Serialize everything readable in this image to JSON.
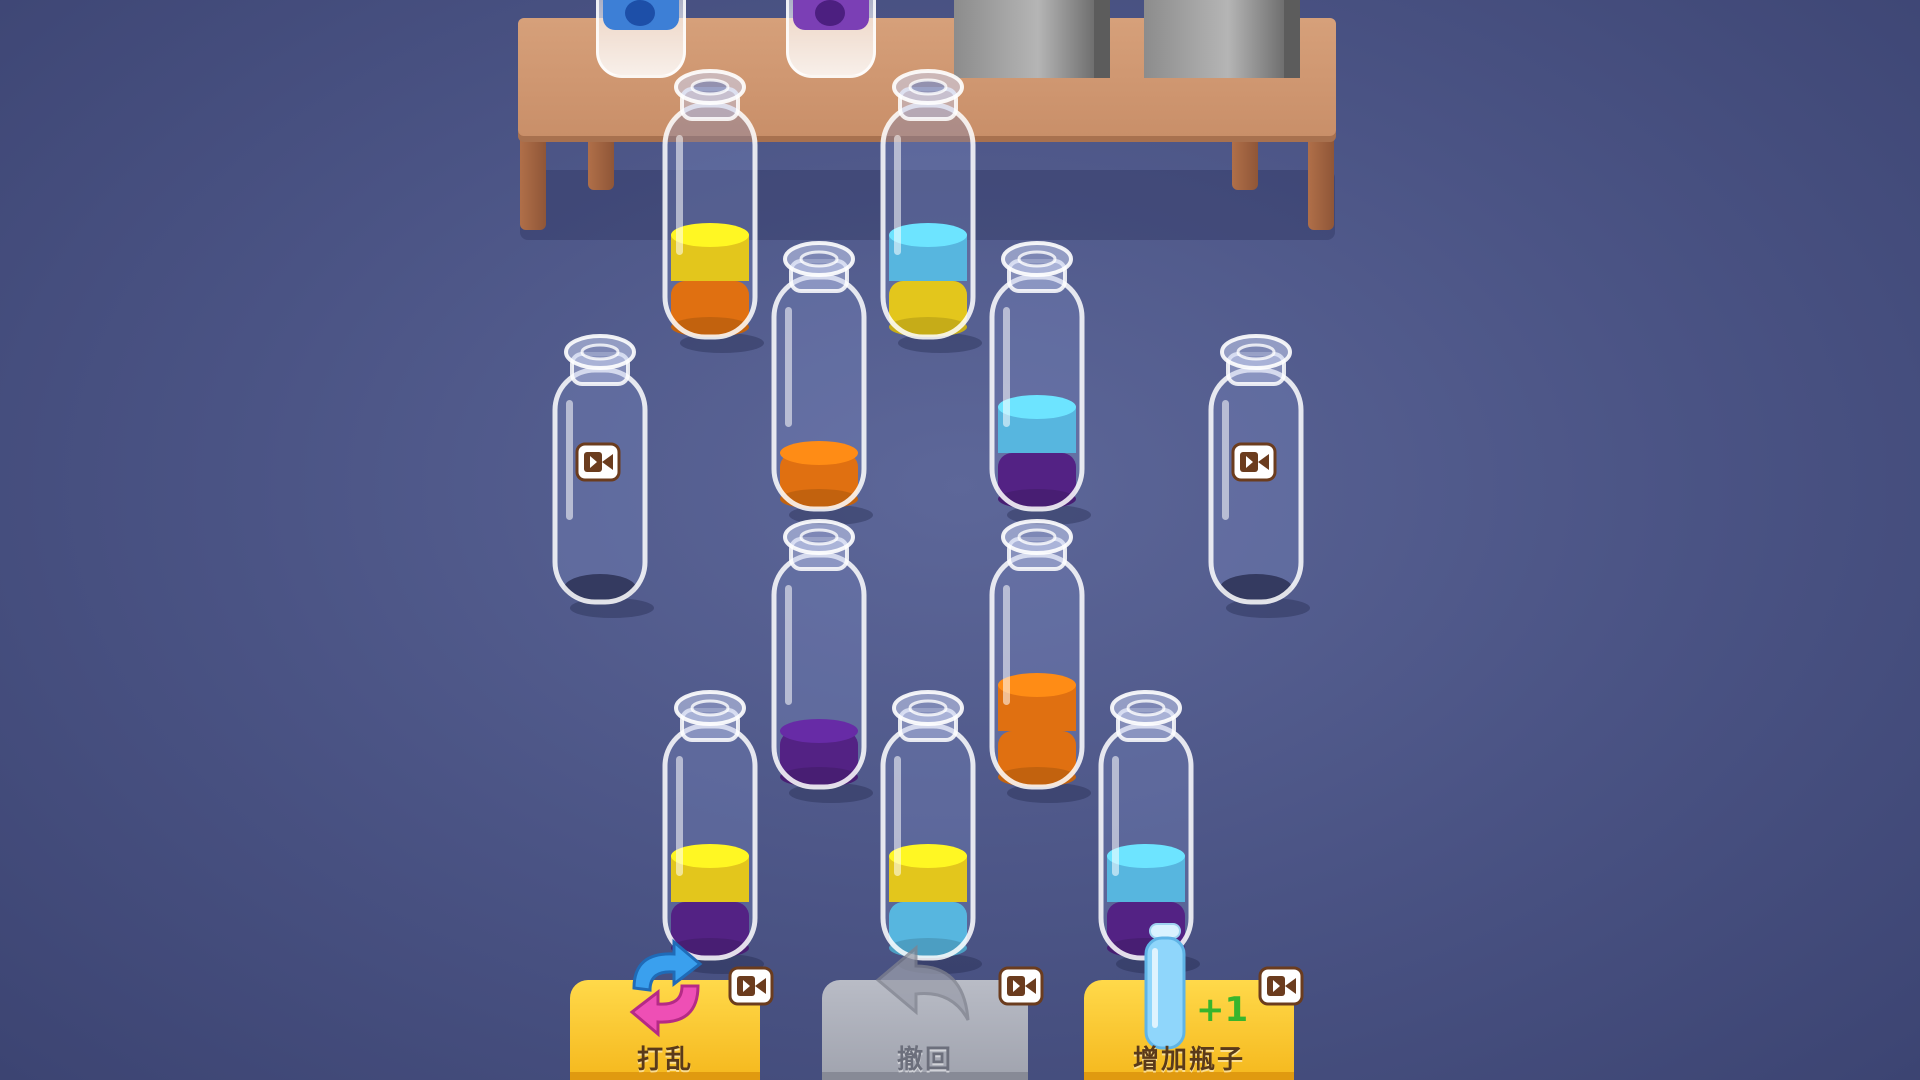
{
  "game": {
    "colors": {
      "yellow": "#f7d71e",
      "orange": "#f37a12",
      "cyan": "#5fc6f2",
      "purple": "#5a2590"
    },
    "bottle_capacity": 4,
    "bottles": [
      {
        "id": "b1",
        "layers": [
          "orange",
          "yellow"
        ],
        "locked": false
      },
      {
        "id": "b2",
        "layers": [
          "yellow",
          "cyan"
        ],
        "locked": false
      },
      {
        "id": "b3",
        "layers": [
          "orange"
        ],
        "locked": false
      },
      {
        "id": "b4",
        "layers": [
          "purple",
          "cyan"
        ],
        "locked": false
      },
      {
        "id": "b5",
        "layers": [],
        "locked": true
      },
      {
        "id": "b6",
        "layers": [],
        "locked": true
      },
      {
        "id": "b7",
        "layers": [
          "purple"
        ],
        "locked": false
      },
      {
        "id": "b8",
        "layers": [
          "orange",
          "orange"
        ],
        "locked": false
      },
      {
        "id": "b9",
        "layers": [
          "purple",
          "yellow"
        ],
        "locked": false
      },
      {
        "id": "b10",
        "layers": [
          "cyan",
          "yellow"
        ],
        "locked": false
      },
      {
        "id": "b11",
        "layers": [
          "purple",
          "cyan"
        ],
        "locked": false
      }
    ]
  },
  "shelf": {
    "items": [
      {
        "name": "blueberry-cup",
        "color": "#3d7fd6"
      },
      {
        "name": "grape-cup",
        "color": "#7b3fb5"
      },
      {
        "name": "locked-box"
      },
      {
        "name": "locked-box"
      }
    ]
  },
  "toolbar": {
    "shuffle": {
      "label": "打乱",
      "icon": "shuffle-arrows-icon",
      "needs_video": true
    },
    "undo": {
      "label": "撤回",
      "icon": "undo-arrow-icon",
      "needs_video": true,
      "disabled": true
    },
    "add_bottle": {
      "label": "增加瓶子",
      "badge": "+1",
      "icon": "bottle-icon",
      "needs_video": true
    }
  }
}
